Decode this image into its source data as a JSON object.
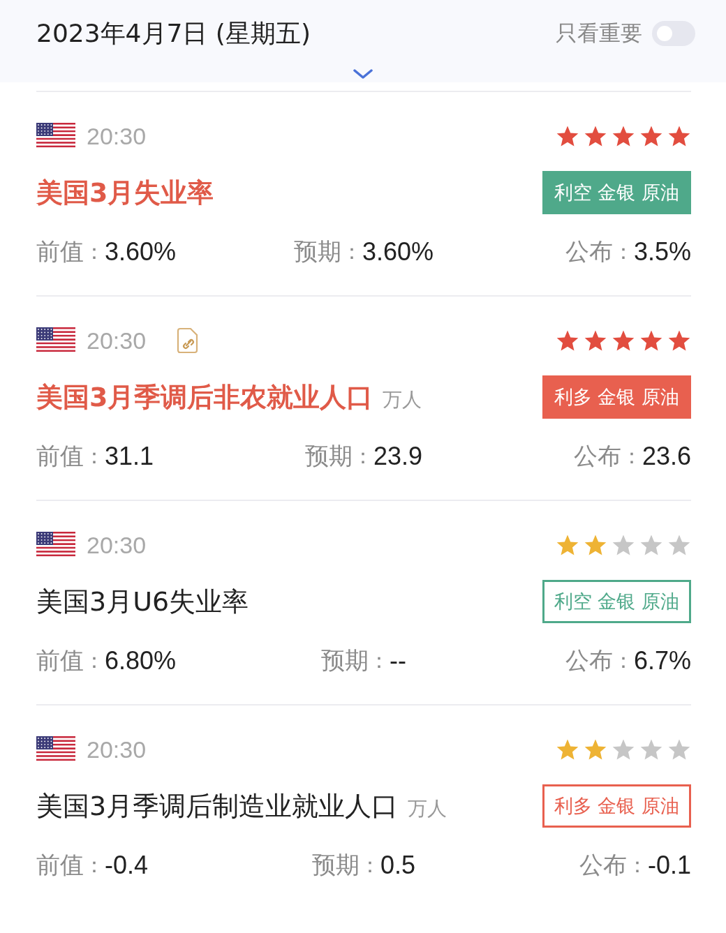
{
  "header": {
    "date": "2023年4月7日 (星期五)",
    "filter": {
      "label": "只看重要",
      "on": false
    }
  },
  "events": [
    {
      "time": "20:30",
      "has_attachment": false,
      "stars": 5,
      "title": "美国3月失业率",
      "highlighted": true,
      "tag": {
        "text": "利空 金银 原油",
        "color": "#4fa98a",
        "filled": true
      },
      "values": [
        {
          "label": "前值",
          "sep": "：",
          "value": "3.60%"
        },
        {
          "label": "预期",
          "sep": "：",
          "value": "3.60%"
        },
        {
          "label": "公布",
          "sep": "：",
          "value": "3.5%"
        }
      ]
    },
    {
      "time": "20:30",
      "has_attachment": true,
      "stars": 5,
      "title": "美国3月季调后非农就业人口",
      "unit": "万人",
      "highlighted": true,
      "tag": {
        "text": "利多 金银 原油",
        "color": "#e8604f",
        "filled": true
      },
      "values": [
        {
          "label": "前值",
          "sep": "：",
          "value": "31.1"
        },
        {
          "label": "预期",
          "sep": "：",
          "value": "23.9"
        },
        {
          "label": "公布",
          "sep": "：",
          "value": "23.6"
        }
      ]
    },
    {
      "time": "20:30",
      "has_attachment": false,
      "stars": 2,
      "title": "美国3月U6失业率",
      "highlighted": false,
      "tag": {
        "text": "利空 金银 原油",
        "color": "#4fa98a",
        "filled": false
      },
      "values": [
        {
          "label": "前值",
          "sep": "：",
          "value": "6.80%"
        },
        {
          "label": "预期",
          "sep": "：",
          "value": "--"
        },
        {
          "label": "公布",
          "sep": "：",
          "value": "6.7%"
        }
      ]
    },
    {
      "time": "20:30",
      "has_attachment": false,
      "stars": 2,
      "title": "美国3月季调后制造业就业人口",
      "unit": "万人",
      "highlighted": false,
      "tag": {
        "text": "利多 金银 原油",
        "color": "#e8604f",
        "filled": false
      },
      "values": [
        {
          "label": "前值",
          "sep": "：",
          "value": "-0.4"
        },
        {
          "label": "预期",
          "sep": "：",
          "value": "0.5"
        },
        {
          "label": "公布",
          "sep": "：",
          "value": "-0.1"
        }
      ]
    }
  ]
}
